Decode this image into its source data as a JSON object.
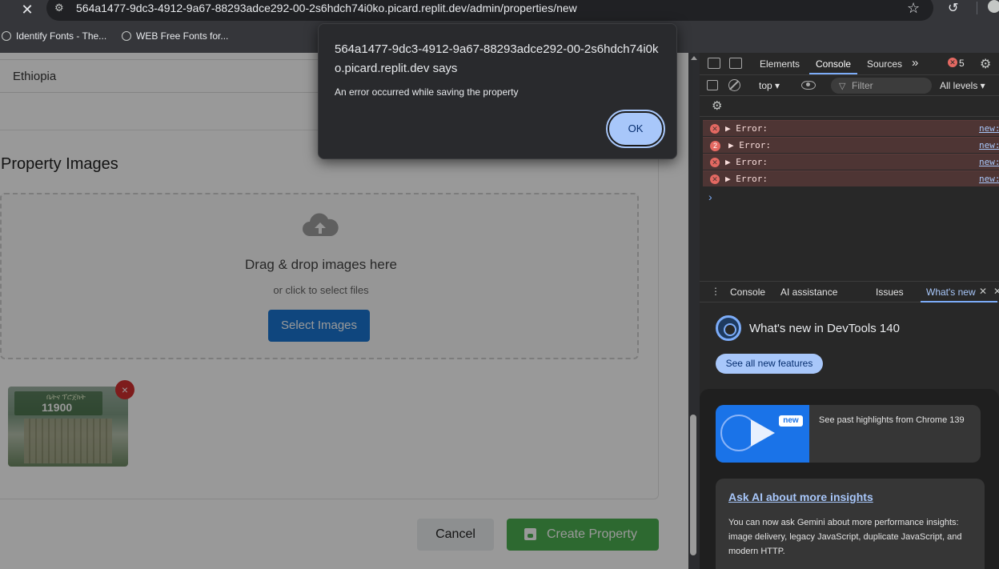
{
  "browser": {
    "url": "564a1477-9dc3-4912-9a67-88293adce292-00-2s6hdch74i0ko.picard.replit.dev/admin/properties/new",
    "bookmarks": [
      "Identify Fonts - The...",
      "WEB Free Fonts for..."
    ]
  },
  "page": {
    "country_value": "Ethiopia",
    "images_section_title": "Property Images",
    "dropzone": {
      "title": "Drag & drop images here",
      "subtitle": "or click to select files",
      "button_label": "Select Images"
    },
    "thumbnail": {
      "banner_small": "ቤትና ፕሮጀክት",
      "banner_large": "11900"
    },
    "remove_label": "×",
    "cancel_label": "Cancel",
    "create_label": "Create Property",
    "colors": {
      "primary": "#1976d2",
      "success": "#4caf50",
      "danger": "#d32f2f"
    }
  },
  "dialog": {
    "title": "564a1477-9dc3-4912-9a67-88293adce292-00-2s6hdch74i0ko.picard.replit.dev says",
    "message": "An error occurred while saving the property",
    "ok_label": "OK"
  },
  "devtools": {
    "tabs": [
      "Elements",
      "Console",
      "Sources",
      "»"
    ],
    "active_tab": "Console",
    "error_count": "5",
    "context": "top ▾",
    "filter_placeholder": "Filter",
    "levels": "All levels ▾",
    "console_rows": [
      {
        "count": "",
        "text": "▶ Error:",
        "link": "new:"
      },
      {
        "count": "2",
        "text": "▶ Error:",
        "link": "new:"
      },
      {
        "count": "",
        "text": "▶ Error:",
        "link": "new:"
      },
      {
        "count": "",
        "text": "▶ Error:",
        "link": "new:"
      }
    ],
    "prompt": "›",
    "drawer_tabs": [
      "Console",
      "AI assistance",
      "Issues",
      "What's new"
    ],
    "whats_new": {
      "title": "What's new in DevTools 140",
      "see_all_label": "See all new features",
      "highlight_badge": "new",
      "highlight_text": "See past highlights from Chrome 139",
      "ai_title": "Ask AI about more insights",
      "ai_body": "You can now ask Gemini about more performance insights: image delivery, legacy JavaScript, duplicate JavaScript, and modern HTTP."
    }
  }
}
